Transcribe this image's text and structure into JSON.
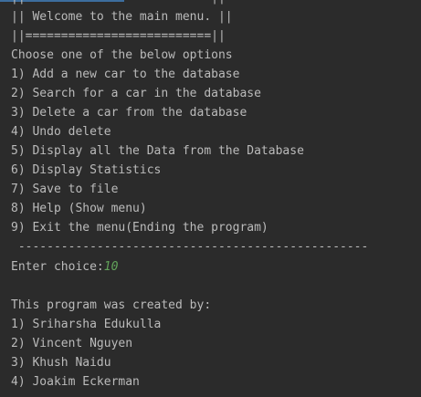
{
  "console": {
    "banner": {
      "top_border": "||                          ||",
      "welcome": "|| Welcome to the main menu. ||",
      "separator": "||==========================||"
    },
    "prompt": "Choose one of the below options",
    "menu_items": [
      "1) Add a new car to the database",
      "2) Search for a car in the database",
      "3) Delete a car from the database",
      "4) Undo delete",
      "5) Display all the Data from the Database",
      "6) Display Statistics",
      "7) Save to file",
      "8) Help (Show menu)",
      "9) Exit the menu(Ending the program)"
    ],
    "divider": " -------------------------------------------------",
    "choice_label": "Enter choice:",
    "choice_value": "10",
    "credits_heading": "This program was created by:",
    "credits": [
      "1) Sriharsha Edukulla",
      "2) Vincent Nguyen",
      "3) Khush Naidu",
      "4) Joakim Eckerman"
    ],
    "colors": {
      "background": "#2b2b2b",
      "text": "#bbbbbb",
      "user_input": "#62a35a"
    }
  }
}
